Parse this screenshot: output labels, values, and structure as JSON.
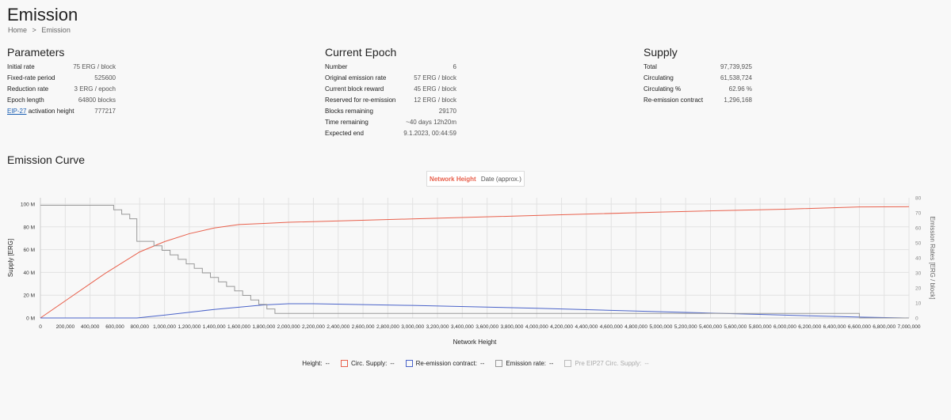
{
  "page": {
    "title": "Emission",
    "breadcrumb": [
      "Home",
      ">",
      "Emission"
    ]
  },
  "parameters": {
    "title": "Parameters",
    "rows": [
      {
        "k": "Initial rate",
        "v": "75 ERG / block"
      },
      {
        "k": "Fixed-rate period",
        "v": "525600"
      },
      {
        "k": "Reduction rate",
        "v": "3 ERG / epoch"
      },
      {
        "k": "Epoch length",
        "v": "64800 blocks"
      }
    ],
    "eip_link": "EIP-27",
    "eip_label": " activation height",
    "eip_value": "777217"
  },
  "epoch": {
    "title": "Current Epoch",
    "rows": [
      {
        "k": "Number",
        "v": "6"
      },
      {
        "k": "Original emission rate",
        "v": "57 ERG / block"
      },
      {
        "k": "Current block reward",
        "v": "45 ERG / block"
      },
      {
        "k": "Reserved for re-emission",
        "v": "12 ERG / block"
      },
      {
        "k": "Blocks remaining",
        "v": "29170"
      },
      {
        "k": "Time remaining",
        "v": "~40 days 12h20m"
      },
      {
        "k": "Expected end",
        "v": "9.1.2023, 00:44:59"
      }
    ]
  },
  "supply": {
    "title": "Supply",
    "rows": [
      {
        "k": "Total",
        "v": "97,739,925"
      },
      {
        "k": "Circulating",
        "v": "61,538,724"
      },
      {
        "k": "Circulating %",
        "v": "62.96 %"
      },
      {
        "k": "Re-emission contract",
        "v": "1,296,168"
      }
    ]
  },
  "curve": {
    "title": "Emission Curve",
    "toggle_on": "Network Height",
    "toggle_off": "Date (approx.)"
  },
  "legend": {
    "height_label": "Height:",
    "height_value": "--",
    "circ_label": "Circ. Supply:",
    "circ_value": "--",
    "reem_label": "Re-emission contract:",
    "reem_value": "--",
    "rate_label": "Emission rate:",
    "rate_value": "--",
    "pre_label": "Pre EIP27 Circ. Supply:",
    "pre_value": "--"
  },
  "colors": {
    "circ": "#e8604c",
    "reem": "#4a63c9",
    "rate": "#999999",
    "pre": "#bbbbbb"
  },
  "chart_data": {
    "type": "line",
    "xlabel": "Network Height",
    "ylabel": "Supply [ERG]",
    "y2label": "Emission Rates [ERG / block]",
    "xlim": [
      0,
      7000000
    ],
    "ylim": [
      0,
      100000000
    ],
    "y2lim": [
      0,
      80
    ],
    "x_ticks": [
      "0",
      "200,000",
      "400,000",
      "600,000",
      "800,000",
      "1,000,000",
      "1,200,000",
      "1,400,000",
      "1,600,000",
      "1,800,000",
      "2,000,000",
      "2,200,000",
      "2,400,000",
      "2,600,000",
      "2,800,000",
      "3,000,000",
      "3,200,000",
      "3,400,000",
      "3,600,000",
      "3,800,000",
      "4,000,000",
      "4,200,000",
      "4,400,000",
      "4,600,000",
      "4,800,000",
      "5,000,000",
      "5,200,000",
      "5,400,000",
      "5,600,000",
      "5,800,000",
      "6,000,000",
      "6,200,000",
      "6,400,000",
      "6,600,000",
      "6,800,000",
      "7,000,000"
    ],
    "y_ticks": [
      "0 M",
      "20 M",
      "40 M",
      "60 M",
      "80 M",
      "100 M"
    ],
    "y2_ticks": [
      "0",
      "10",
      "20",
      "30",
      "40",
      "50",
      "60",
      "70",
      "80"
    ],
    "series": [
      {
        "name": "Circ. Supply",
        "axis": "left",
        "points": [
          [
            0,
            0
          ],
          [
            200000,
            15000000
          ],
          [
            400000,
            30000000
          ],
          [
            525600,
            39400000
          ],
          [
            800000,
            58000000
          ],
          [
            1000000,
            67000000
          ],
          [
            1200000,
            74000000
          ],
          [
            1400000,
            79000000
          ],
          [
            1600000,
            82000000
          ],
          [
            1800000,
            83000000
          ],
          [
            2000000,
            84000000
          ],
          [
            3000000,
            87000000
          ],
          [
            4000000,
            90000000
          ],
          [
            5000000,
            93000000
          ],
          [
            6000000,
            95500000
          ],
          [
            6600000,
            97500000
          ],
          [
            7000000,
            97700000
          ]
        ]
      },
      {
        "name": "Re-emission contract",
        "axis": "left",
        "points": [
          [
            0,
            0
          ],
          [
            777217,
            0
          ],
          [
            1000000,
            2500000
          ],
          [
            1400000,
            7500000
          ],
          [
            1800000,
            11500000
          ],
          [
            2000000,
            12500000
          ],
          [
            2200000,
            12500000
          ],
          [
            3000000,
            11000000
          ],
          [
            4000000,
            8500000
          ],
          [
            5000000,
            5500000
          ],
          [
            6000000,
            2500000
          ],
          [
            6600000,
            800000
          ],
          [
            7000000,
            0
          ]
        ]
      },
      {
        "name": "Emission rate",
        "axis": "right",
        "step": true,
        "points": [
          [
            0,
            75
          ],
          [
            525600,
            75
          ],
          [
            590400,
            72
          ],
          [
            655200,
            69
          ],
          [
            720000,
            66
          ],
          [
            777217,
            66
          ],
          [
            777217,
            51
          ],
          [
            850000,
            51
          ],
          [
            915000,
            48
          ],
          [
            980000,
            45
          ],
          [
            1045000,
            42
          ],
          [
            1110000,
            39
          ],
          [
            1175000,
            36
          ],
          [
            1240000,
            33
          ],
          [
            1305000,
            30
          ],
          [
            1370000,
            27
          ],
          [
            1435000,
            24
          ],
          [
            1500000,
            21
          ],
          [
            1565000,
            18
          ],
          [
            1630000,
            15
          ],
          [
            1695000,
            12
          ],
          [
            1760000,
            9
          ],
          [
            1825000,
            6
          ],
          [
            1890000,
            3
          ],
          [
            2200000,
            3
          ],
          [
            6600000,
            3
          ],
          [
            6600000,
            0
          ],
          [
            7000000,
            0
          ]
        ]
      }
    ]
  }
}
